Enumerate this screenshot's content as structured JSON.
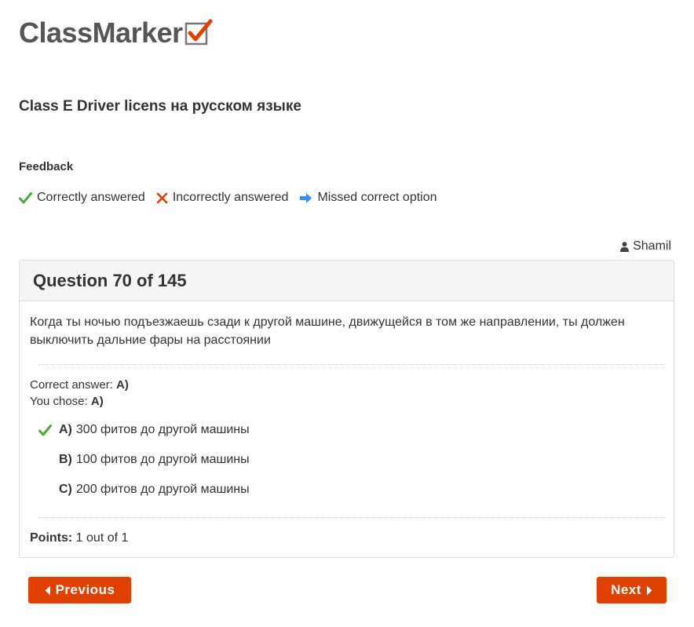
{
  "brand": {
    "logo_text": "ClassMarker",
    "check_color": "#e04000"
  },
  "test": {
    "title": "Class E Driver licens на русском языке"
  },
  "feedback": {
    "heading": "Feedback",
    "legend": {
      "correct": "Correctly answered",
      "incorrect": "Incorrectly answered",
      "missed": "Missed correct option"
    },
    "colors": {
      "correct": "#4caa3a",
      "incorrect": "#e04000",
      "missed": "#3a8ee6"
    }
  },
  "user": {
    "name": "Shamil",
    "icon": "user-icon"
  },
  "question": {
    "header": "Question 70 of 145",
    "text": "Когда ты ночью подъезжаешь сзади к другой машине, движущейся в том же направлении, ты должен выключить дальние фары на расстоянии",
    "correct_answer_label": "Correct answer:",
    "correct_answer_value": "A)",
    "you_chose_label": "You chose:",
    "you_chose_value": "A)",
    "options": [
      {
        "letter": "A)",
        "text": "300 фитов до другой машины",
        "mark": "check-icon"
      },
      {
        "letter": "B)",
        "text": "100 фитов до другой машины",
        "mark": ""
      },
      {
        "letter": "C)",
        "text": "200 фитов до другой машины",
        "mark": ""
      }
    ],
    "points_label": "Points:",
    "points_value": "1 out of 1"
  },
  "navigation": {
    "previous_label": "Previous",
    "next_label": "Next",
    "button_color": "#e04000"
  }
}
